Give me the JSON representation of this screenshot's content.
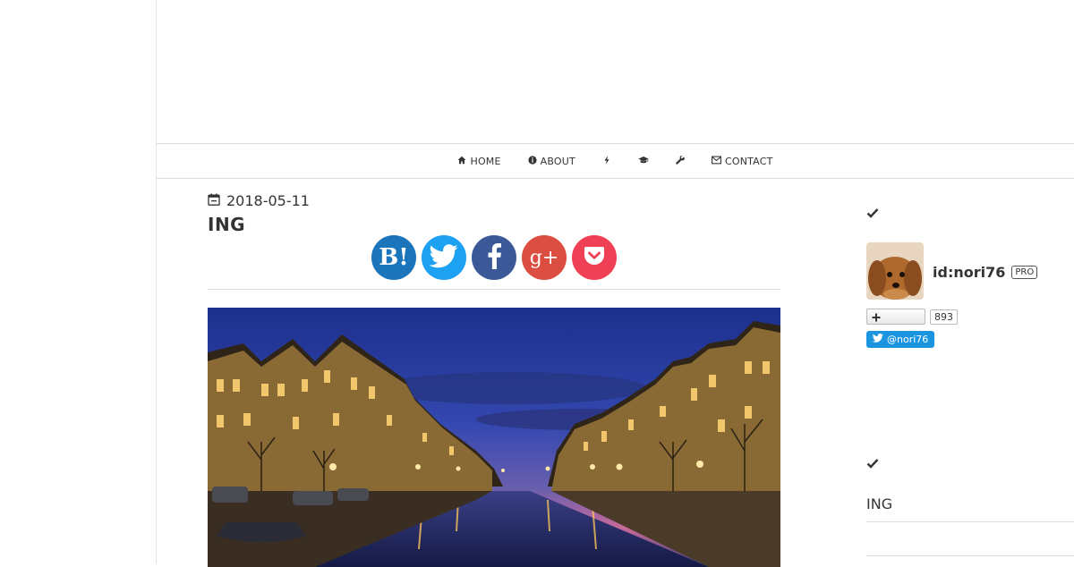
{
  "nav": {
    "items": [
      {
        "label": "HOME",
        "icon": "home-icon"
      },
      {
        "label": "ABOUT",
        "icon": "info-icon"
      },
      {
        "label": "",
        "icon": "bolt-icon"
      },
      {
        "label": "",
        "icon": "graduation-cap-icon"
      },
      {
        "label": "",
        "icon": "wrench-icon"
      },
      {
        "label": "CONTACT",
        "icon": "envelope-icon"
      }
    ]
  },
  "post": {
    "date": "2018-05-11",
    "title": "ING"
  },
  "share": {
    "hatena_label": "B!",
    "gplus_label": "g+"
  },
  "sidebar": {
    "user_id": "id:nori76",
    "badge": "PRO",
    "follower_count": "893",
    "twitter_handle": "@nori76",
    "recent_link": "ING"
  },
  "colors": {
    "hatena": "#1b75bb",
    "twitter": "#1da1f2",
    "facebook": "#3b5998",
    "gplus": "#dc4e41",
    "pocket": "#ef4056",
    "twitter_follow": "#1b95e0"
  }
}
